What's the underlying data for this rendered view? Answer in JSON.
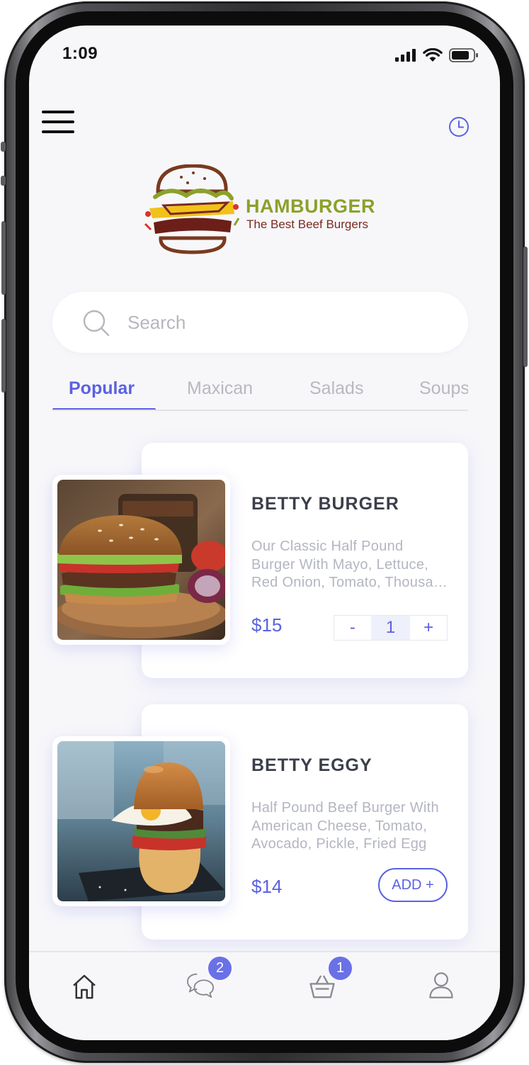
{
  "status_bar": {
    "time": "1:09"
  },
  "header": {
    "menu_icon": "hamburger-menu-icon",
    "history_icon": "clock-icon"
  },
  "brand": {
    "title": "HAMBURGER",
    "subtitle": "The Best Beef Burgers"
  },
  "search": {
    "placeholder": "Search",
    "value": ""
  },
  "tabs": [
    {
      "label": "Popular",
      "active": true
    },
    {
      "label": "Maxican",
      "active": false
    },
    {
      "label": "Salads",
      "active": false
    },
    {
      "label": "Soups",
      "active": false
    }
  ],
  "items": [
    {
      "name": "BETTY BURGER",
      "description": "Our Classic Half Pound Burger With Mayo, Lettuce, Red Onion, Tomato, Thousand Island",
      "price": "$15",
      "quantity": "1",
      "decrement_label": "-",
      "increment_label": "+"
    },
    {
      "name": "BETTY EGGY",
      "description": "Half Pound Beef Burger With American Cheese, Tomato, Avocado, Pickle, Fried Egg",
      "price": "$14",
      "add_label": "ADD +"
    }
  ],
  "bottom_nav": {
    "items": [
      {
        "icon": "home-icon"
      },
      {
        "icon": "chat-icon",
        "badge": "2"
      },
      {
        "icon": "basket-icon",
        "badge": "1"
      },
      {
        "icon": "user-icon"
      }
    ]
  },
  "colors": {
    "accent": "#5b62e0",
    "background": "#f7f7fa",
    "muted": "#b8b8c0",
    "brand_green": "#8ba12a",
    "brand_brown": "#7a2a1f"
  }
}
